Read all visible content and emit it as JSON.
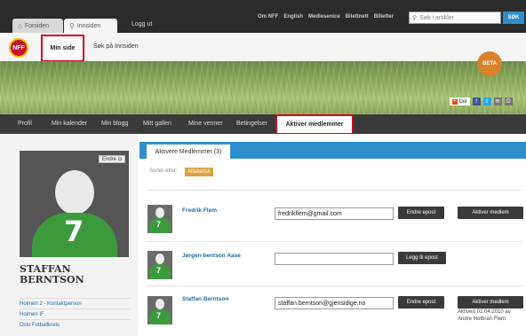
{
  "topbar": {
    "tabs": [
      {
        "label": "Forsiden"
      },
      {
        "label": "Innsiden"
      }
    ],
    "logout": "Logg ut",
    "links": [
      "Om NFF",
      "English",
      "Mediesenice",
      "Bilettnett",
      "Billetter"
    ],
    "search_placeholder": "Søk i artikler",
    "search_button": "SØK"
  },
  "subnav": {
    "logo": "NFF",
    "min_side": "Min side",
    "sok": "Søk på Innsiden"
  },
  "banner": {
    "beta": "BETA",
    "del": "Del"
  },
  "mainnav": {
    "items": [
      "Profil",
      "Min kalender",
      "Min blogg",
      "Mitt galleri",
      "Mine venner",
      "Betingelser"
    ],
    "active": "Aktiver medlemmer"
  },
  "profile": {
    "name": "STAFFAN BERNTSON",
    "edit": "Endre",
    "jersey_number": "7",
    "links": [
      "Holmen 2 - Kontaktperson",
      "Holmen IF",
      "Oslo Fotballkrets"
    ]
  },
  "content": {
    "tab": "Aktivere Medlemmer (3)",
    "sort_label": "Sorter etter:",
    "sort_value": "Alfabetisk",
    "members": [
      {
        "name": "Fredrik Flem",
        "email": "fredrikflem@gmail.com",
        "edit_button": "Endre epost",
        "action_button": "Aktiver medlem"
      },
      {
        "name": "Jørgen bentson Aase",
        "email": "",
        "edit_button": "Legg til epost",
        "action_button": ""
      },
      {
        "name": "Staffan Berntson",
        "email": "staffan.berntson@gjensidige.no",
        "edit_button": "Endre epost",
        "action_button": "Aktiver medlem",
        "note": "Aktivert 01.04.2010 av Andre Hotbran Flem"
      }
    ]
  },
  "colors": {
    "accent_blue": "#2e8ec9",
    "highlight_red": "#d0021b",
    "dark_bar": "#2b2b2b"
  }
}
